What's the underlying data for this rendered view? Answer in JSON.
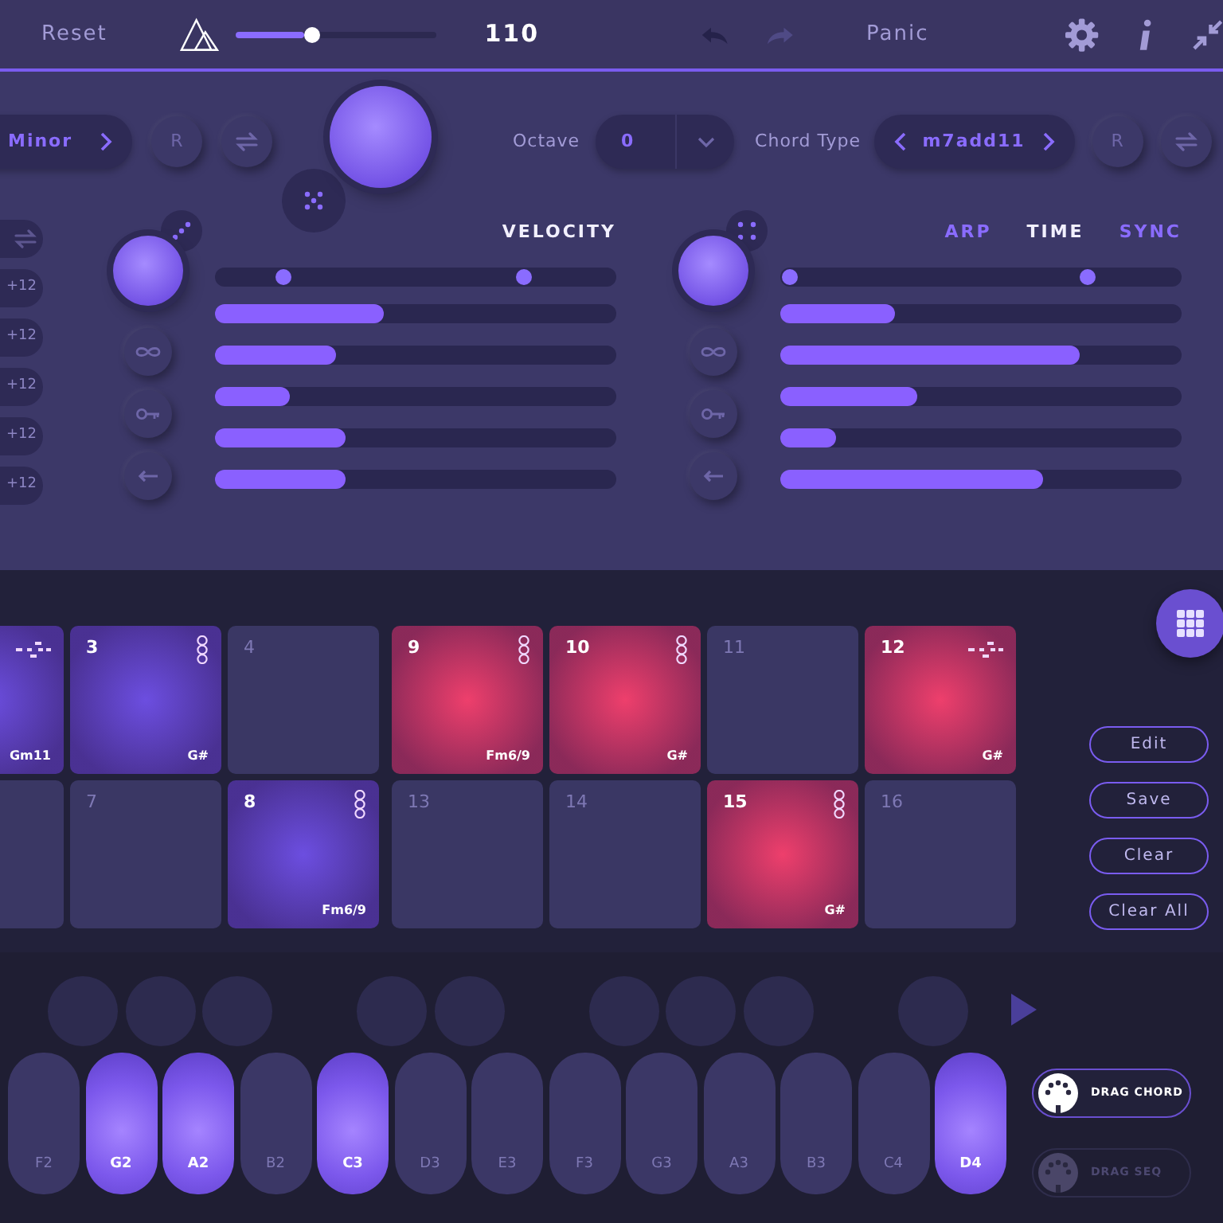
{
  "top_bar": {
    "reset": "Reset",
    "tempo": {
      "level": 0.385,
      "reading": "110"
    },
    "undo": {
      "disabled": false
    },
    "redo": {
      "disabled": true
    },
    "panic": "Panic"
  },
  "chord_row": {
    "scale": {
      "value": "Minor"
    },
    "scale_random": "R",
    "octave": {
      "label": "Octave",
      "value": "0"
    },
    "chord_type": {
      "label": "Chord Type",
      "value": "m7add11"
    },
    "chord_random": "R"
  },
  "side_toggles": [
    {
      "kind": "swap"
    },
    {
      "kind": "text",
      "label": "+12"
    },
    {
      "kind": "text",
      "label": "+12"
    },
    {
      "kind": "text",
      "label": "+12"
    },
    {
      "kind": "text",
      "label": "+12"
    },
    {
      "kind": "text",
      "label": "+12"
    }
  ],
  "panels": [
    {
      "tabs": [
        {
          "label": "VELOCITY",
          "selected": true
        }
      ],
      "thumbs": [
        {
          "level": 0.17
        },
        {
          "level": 0.77
        }
      ],
      "bars": [
        {
          "level": 0.42
        },
        {
          "level": 0.3
        },
        {
          "level": 0.185
        },
        {
          "level": 0.325
        },
        {
          "level": 0.325
        }
      ]
    },
    {
      "tabs": [
        {
          "label": "ARP",
          "selected": false
        },
        {
          "label": "TIME",
          "selected": true
        },
        {
          "label": "SYNC",
          "selected": false
        }
      ],
      "thumbs": [
        {
          "level": 0.025
        },
        {
          "level": 0.765
        }
      ],
      "bars": [
        {
          "level": 0.285
        },
        {
          "level": 0.745
        },
        {
          "level": 0.34
        },
        {
          "level": 0.14
        },
        {
          "level": 0.655
        }
      ]
    }
  ],
  "pad_rows": [
    {
      "pads": [
        {
          "kind": "sequence",
          "color": "#6c4ee0",
          "chord": "Gm11"
        },
        {
          "kind": "chord",
          "number": "3",
          "color": "#6c4ee0",
          "chord": "G#"
        },
        {
          "kind": "empty",
          "number": "4"
        },
        {
          "kind": "chord",
          "number": "9",
          "color": "#ee3f6c",
          "chord": "Fm6/9"
        },
        {
          "kind": "chord",
          "number": "10",
          "color": "#ee3f6c",
          "chord": "G#"
        },
        {
          "kind": "empty",
          "number": "11"
        },
        {
          "kind": "sequence",
          "number": "12",
          "color": "#ee3f6c",
          "chord": "G#"
        }
      ]
    },
    {
      "pads": [
        {
          "kind": "empty"
        },
        {
          "kind": "empty",
          "number": "7"
        },
        {
          "kind": "chord",
          "number": "8",
          "color": "#6c4ee0",
          "chord": "Fm6/9"
        },
        {
          "kind": "empty",
          "number": "13"
        },
        {
          "kind": "empty",
          "number": "14"
        },
        {
          "kind": "chord",
          "number": "15",
          "color": "#ee3f6c",
          "chord": "G#"
        },
        {
          "kind": "empty",
          "number": "16"
        }
      ]
    }
  ],
  "side_buttons": [
    "Edit",
    "Save",
    "Clear",
    "Clear All"
  ],
  "keys": [
    {
      "label": "F2",
      "on": false,
      "sharp": true
    },
    {
      "label": "G2",
      "on": true,
      "sharp": true
    },
    {
      "label": "A2",
      "on": true,
      "sharp": true
    },
    {
      "label": "B2",
      "on": false,
      "sharp": false
    },
    {
      "label": "C3",
      "on": true,
      "sharp": true
    },
    {
      "label": "D3",
      "on": false,
      "sharp": true
    },
    {
      "label": "E3",
      "on": false,
      "sharp": false
    },
    {
      "label": "F3",
      "on": false,
      "sharp": true
    },
    {
      "label": "G3",
      "on": false,
      "sharp": true
    },
    {
      "label": "A3",
      "on": false,
      "sharp": true
    },
    {
      "label": "B3",
      "on": false,
      "sharp": false
    },
    {
      "label": "C4",
      "on": false,
      "sharp": true
    },
    {
      "label": "D4",
      "on": true,
      "sharp": false
    }
  ],
  "drag_buttons": [
    {
      "label": "DRAG CHORD",
      "disabled": false
    },
    {
      "label": "DRAG SEQ",
      "disabled": true
    }
  ]
}
